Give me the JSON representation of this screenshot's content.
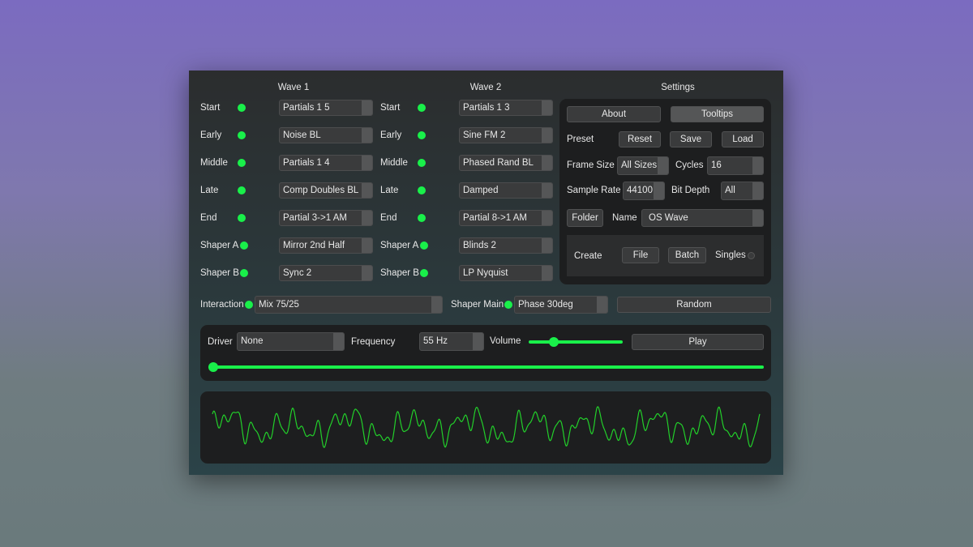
{
  "headers": {
    "wave1": "Wave 1",
    "wave2": "Wave 2",
    "settings": "Settings"
  },
  "wave1": [
    {
      "label": "Start",
      "value": "Partials 1 5"
    },
    {
      "label": "Early",
      "value": "Noise BL"
    },
    {
      "label": "Middle",
      "value": "Partials 1 4"
    },
    {
      "label": "Late",
      "value": "Comp Doubles BL"
    },
    {
      "label": "End",
      "value": "Partial 3->1 AM"
    },
    {
      "label": "Shaper A",
      "value": "Mirror 2nd Half"
    },
    {
      "label": "Shaper B",
      "value": "Sync 2"
    }
  ],
  "wave2": [
    {
      "label": "Start",
      "value": "Partials 1 3"
    },
    {
      "label": "Early",
      "value": "Sine FM 2"
    },
    {
      "label": "Middle",
      "value": "Phased Rand BL"
    },
    {
      "label": "Late",
      "value": "Damped"
    },
    {
      "label": "End",
      "value": "Partial 8->1 AM"
    },
    {
      "label": "Shaper A",
      "value": "Blinds 2"
    },
    {
      "label": "Shaper B",
      "value": "LP Nyquist"
    }
  ],
  "settings": {
    "about": "About",
    "tooltips": "Tooltips",
    "preset_label": "Preset",
    "reset": "Reset",
    "save": "Save",
    "load": "Load",
    "frame_size_label": "Frame Size",
    "frame_size": "All Sizes",
    "cycles_label": "Cycles",
    "cycles": "16",
    "sample_rate_label": "Sample Rate",
    "sample_rate": "44100",
    "bit_depth_label": "Bit Depth",
    "bit_depth": "All",
    "folder": "Folder",
    "name_label": "Name",
    "name_value": "OS Wave",
    "create_label": "Create",
    "file": "File",
    "batch": "Batch",
    "singles_label": "Singles",
    "singles_checked": false
  },
  "interaction": {
    "label": "Interaction",
    "value": "Mix 75/25"
  },
  "shaper_main": {
    "label": "Shaper Main",
    "value": "Phase 30deg"
  },
  "random": "Random",
  "player": {
    "driver_label": "Driver",
    "driver": "None",
    "frequency_label": "Frequency",
    "frequency": "55 Hz",
    "volume_label": "Volume",
    "volume": 0.27,
    "play": "Play",
    "position": 0
  },
  "colors": {
    "accent": "#19f04a",
    "waveform": "#22d02a"
  }
}
